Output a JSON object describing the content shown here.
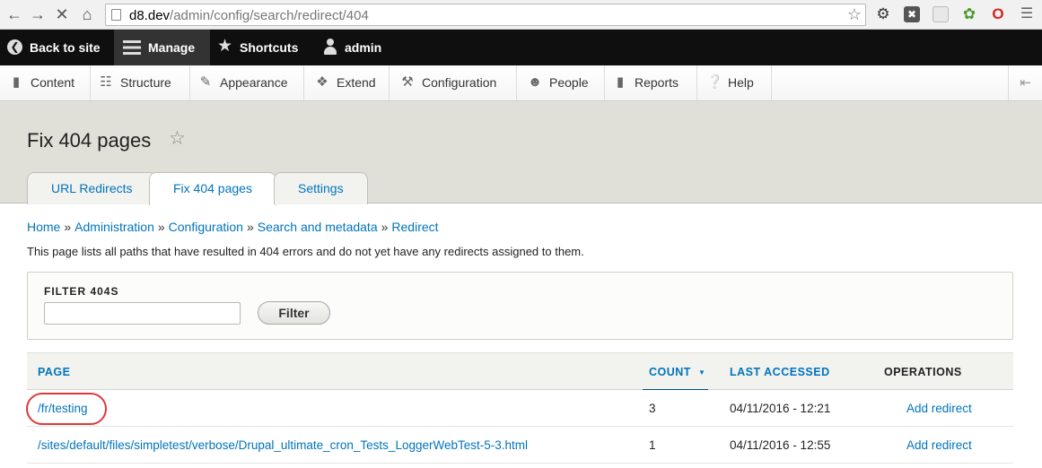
{
  "browser": {
    "url_host": "d8.dev",
    "url_path": "/admin/config/search/redirect/404"
  },
  "toolbar": {
    "back_to_site": "Back to site",
    "manage": "Manage",
    "shortcuts": "Shortcuts",
    "user": "admin"
  },
  "tray": {
    "items": [
      {
        "label": "Content"
      },
      {
        "label": "Structure"
      },
      {
        "label": "Appearance"
      },
      {
        "label": "Extend"
      },
      {
        "label": "Configuration"
      },
      {
        "label": "People"
      },
      {
        "label": "Reports"
      },
      {
        "label": "Help"
      }
    ]
  },
  "page": {
    "title": "Fix 404 pages",
    "tabs": [
      {
        "label": "URL Redirects"
      },
      {
        "label": "Fix 404 pages"
      },
      {
        "label": "Settings"
      }
    ]
  },
  "breadcrumb": [
    {
      "label": "Home"
    },
    {
      "label": "Administration"
    },
    {
      "label": "Configuration"
    },
    {
      "label": "Search and metadata"
    },
    {
      "label": "Redirect"
    }
  ],
  "breadcrumb_sep": "»",
  "description": "This page lists all paths that have resulted in 404 errors and do not yet have any redirects assigned to them.",
  "filter": {
    "label": "FILTER 404S",
    "value": "",
    "button": "Filter"
  },
  "table": {
    "headers": {
      "page": "PAGE",
      "count": "COUNT",
      "last_accessed": "LAST ACCESSED",
      "operations": "OPERATIONS"
    },
    "rows": [
      {
        "page": "/fr/testing",
        "count": "3",
        "last_accessed": "04/11/2016 - 12:21",
        "operation": "Add redirect"
      },
      {
        "page": "/sites/default/files/simpletest/verbose/Drupal_ultimate_cron_Tests_LoggerWebTest-5-3.html",
        "count": "1",
        "last_accessed": "04/11/2016 - 12:55",
        "operation": "Add redirect"
      }
    ]
  },
  "colors": {
    "link": "#0074bd",
    "toolbar_bg": "#0f0f0f",
    "header_bg": "#e0e0d8",
    "annotation": "#e03838"
  }
}
